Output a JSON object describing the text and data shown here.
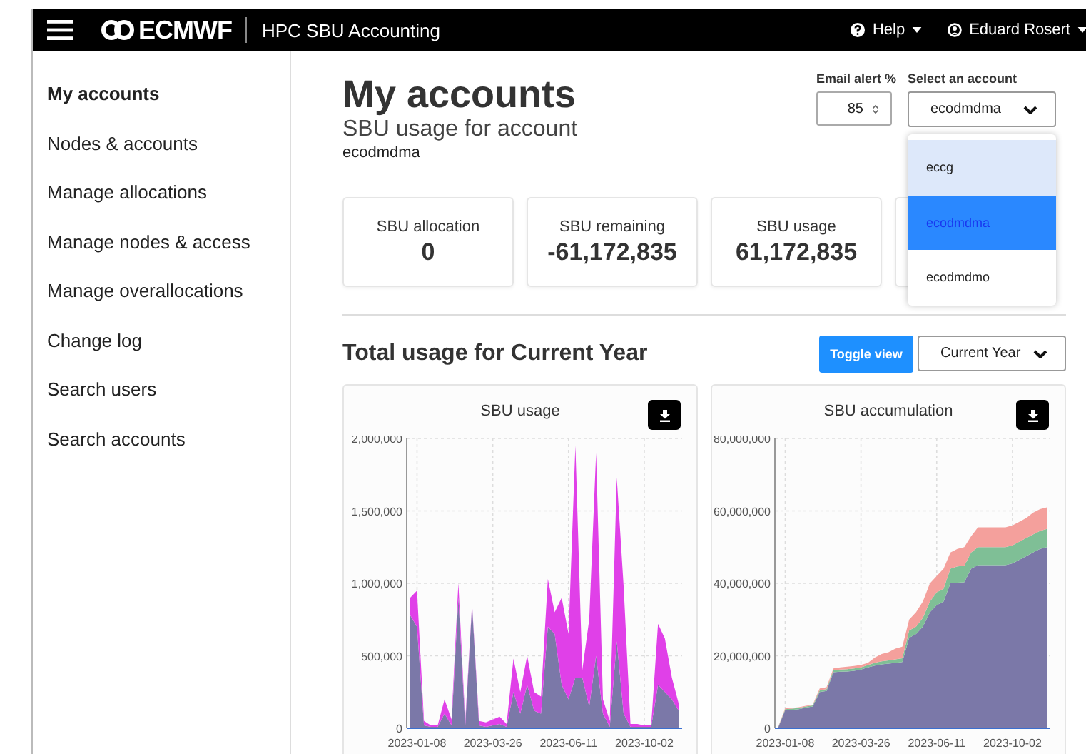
{
  "navbar": {
    "logo": "ECMWF",
    "app_title": "HPC SBU Accounting",
    "help": "Help",
    "user": "Eduard Rosert"
  },
  "sidebar": {
    "items": [
      {
        "label": "My accounts",
        "selected": true
      },
      {
        "label": "Nodes & accounts",
        "selected": false
      },
      {
        "label": "Manage allocations",
        "selected": false
      },
      {
        "label": "Manage nodes & access",
        "selected": false
      },
      {
        "label": "Manage overallocations",
        "selected": false
      },
      {
        "label": "Change log",
        "selected": false
      },
      {
        "label": "Search users",
        "selected": false
      },
      {
        "label": "Search accounts",
        "selected": false
      }
    ]
  },
  "header": {
    "title": "My accounts",
    "subtitle": "SBU usage for account",
    "account": "ecodmdma"
  },
  "email_alert": {
    "label": "Email alert %",
    "value": "85"
  },
  "account_select": {
    "label": "Select an account",
    "value": "ecodmdma",
    "options": [
      {
        "label": "eccg",
        "selected": false,
        "hovered": true
      },
      {
        "label": "ecodmdma",
        "selected": true,
        "hovered": false
      },
      {
        "label": "ecodmdmo",
        "selected": false,
        "hovered": false
      }
    ]
  },
  "stats": [
    {
      "label": "SBU allocation",
      "value": "0"
    },
    {
      "label": "SBU remaining",
      "value": "-61,172,835"
    },
    {
      "label": "SBU usage",
      "value": "61,172,835"
    }
  ],
  "usage_section": {
    "title": "Total usage for Current Year",
    "toggle_button": "Toggle view",
    "period": "Current Year"
  },
  "charts": [
    {
      "chart_data": {
        "type": "area",
        "title": "SBU usage",
        "stacked": true,
        "categories": [
          null,
          "2023-01-08",
          null,
          null,
          null,
          null,
          null,
          null,
          null,
          null,
          null,
          null,
          "2023-03-26",
          null,
          null,
          null,
          null,
          null,
          null,
          null,
          null,
          null,
          null,
          "2023-06-11",
          null,
          null,
          null,
          null,
          null,
          null,
          null,
          null,
          null,
          null,
          "2023-10-02",
          null,
          null,
          null,
          null,
          null
        ],
        "series": [
          {
            "color": "#7b78a8",
            "values": [
              780000,
              700000,
              20000,
              10000,
              10000,
              100000,
              20000,
              900000,
              20000,
              850000,
              20000,
              10000,
              20000,
              30000,
              10000,
              250000,
              100000,
              300000,
              120000,
              100000,
              700000,
              650000,
              300000,
              200000,
              350000,
              350000,
              150000,
              500000,
              100000,
              10000,
              600000,
              100000,
              10000,
              10000,
              10000,
              10000,
              300000,
              250000,
              200000,
              120000
            ]
          },
          {
            "color": "#e040e8",
            "values": [
              120000,
              250000,
              30000,
              10000,
              10000,
              100000,
              40000,
              100000,
              30000,
              10000,
              30000,
              30000,
              40000,
              50000,
              20000,
              230000,
              150000,
              200000,
              130000,
              120000,
              330000,
              150000,
              600000,
              450000,
              1600000,
              50000,
              600000,
              1400000,
              100000,
              40000,
              1130000,
              880000,
              20000,
              20000,
              10000,
              10000,
              420000,
              370000,
              150000,
              50000
            ]
          }
        ],
        "ylim": [
          0,
          2000000
        ],
        "grid": true,
        "yticks": [
          {
            "value": 0,
            "label": "0"
          },
          {
            "value": 500000,
            "label": "500,000"
          },
          {
            "value": 1000000,
            "label": "1,000,000"
          },
          {
            "value": 1500000,
            "label": "1,500,000"
          },
          {
            "value": 2000000,
            "label": "2,000,000"
          }
        ]
      }
    },
    {
      "chart_data": {
        "type": "area",
        "title": "SBU accumulation",
        "stacked": true,
        "categories": [
          null,
          "2023-01-08",
          null,
          null,
          null,
          null,
          null,
          null,
          null,
          null,
          null,
          null,
          "2023-03-26",
          null,
          null,
          null,
          null,
          null,
          null,
          null,
          null,
          null,
          null,
          "2023-06-11",
          null,
          null,
          null,
          null,
          null,
          null,
          null,
          null,
          null,
          null,
          "2023-10-02",
          null,
          null,
          null,
          null,
          null
        ],
        "series": [
          {
            "color": "#7b78a8",
            "values": [
              300000,
              5000000,
              5100000,
              5300000,
              5700000,
              6000000,
              10000000,
              10300000,
              15500000,
              15600000,
              15700000,
              15900000,
              16200000,
              16800000,
              17300000,
              17600000,
              17800000,
              18000000,
              18300000,
              25000000,
              26000000,
              28000000,
              32000000,
              34000000,
              35000000,
              40000000,
              40200000,
              40300000,
              44000000,
              45000000,
              45000000,
              45000000,
              45000000,
              45000000,
              45500000,
              46500000,
              47500000,
              48500000,
              49500000,
              50000000
            ]
          },
          {
            "color": "#7fbf96",
            "values": [
              100000,
              300000,
              300000,
              300000,
              300000,
              300000,
              500000,
              500000,
              500000,
              600000,
              600000,
              600000,
              600000,
              600000,
              800000,
              900000,
              900000,
              1000000,
              1000000,
              2000000,
              2000000,
              2500000,
              3000000,
              3500000,
              3500000,
              4000000,
              4500000,
              4500000,
              4500000,
              5000000,
              5000000,
              5000000,
              5000000,
              5000000,
              5000000,
              5000000,
              5000000,
              5000000,
              5000000,
              5000000
            ]
          },
          {
            "color": "#f4a09c",
            "values": [
              100000,
              200000,
              200000,
              200000,
              200000,
              200000,
              500000,
              500000,
              500000,
              600000,
              700000,
              700000,
              700000,
              600000,
              1400000,
              2000000,
              2300000,
              3000000,
              3200000,
              3000000,
              4000000,
              4500000,
              5000000,
              4500000,
              5500000,
              4500000,
              4800000,
              5200000,
              4500000,
              5500000,
              5500000,
              5500000,
              5500000,
              5500000,
              5500000,
              5500000,
              5500000,
              6000000,
              6000000,
              6000000
            ]
          }
        ],
        "ylim": [
          0,
          80000000
        ],
        "grid": true,
        "yticks": [
          {
            "value": 0,
            "label": "0"
          },
          {
            "value": 20000000,
            "label": "20,000,000"
          },
          {
            "value": 40000000,
            "label": "40,000,000"
          },
          {
            "value": 60000000,
            "label": "60,000,000"
          },
          {
            "value": 80000000,
            "label": "80,000,000"
          }
        ]
      }
    }
  ]
}
